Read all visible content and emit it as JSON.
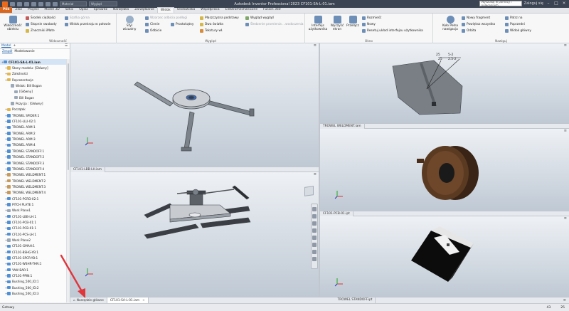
{
  "titlebar": {
    "material_label": "Materiał",
    "appearance_label": "Wygląd",
    "window_title": "Autodesk Inventor Professional 2023    CF101-SA-L-01.iam",
    "help_search_placeholder": "Wyszukaj w pomocy i poleceniach...",
    "user_label": "Zaloguj się"
  },
  "tabs": [
    "Plik",
    "Złóż",
    "Projekt",
    "Model 3D",
    "Szkic",
    "Opisz",
    "Sprawdź",
    "Narzędzia",
    "Zarządzanie",
    "Widok",
    "Środowiska",
    "Współpraca",
    "Elektromechaniczne",
    "Fusion 360"
  ],
  "ribbon": {
    "visibility": {
      "title": "Widoczność",
      "object_visibility": "Widoczność obiektu",
      "center_of_gravity": "Środek ciężkości",
      "degrees_of_freedom": "Stopnie swobody",
      "imate_glyphs": "Znaczniki iMate",
      "hide_others": "Szafka górna",
      "half_section": "Widok przekroju w połowie"
    },
    "appearance": {
      "title": "Wygląd",
      "visual_style": "Styl wizualny",
      "ground_plane": "Wzorzec odbicia podłogi",
      "shadows": "Cienie",
      "reflections": "Odbicie",
      "orthographic": "Prostokątny",
      "ground_plane2": "Płaszczyzna podstawy",
      "two_lights": "Dwa światła",
      "textures": "Tekstury wł.",
      "appearance_style": "Wygląd wygląd",
      "ray_tracing": "Śledzenie promienia ...wodoczenia"
    },
    "window": {
      "title": "Okno",
      "user_interface": "Interfejs użytkownika",
      "clean_screen": "Wyczyść ekran",
      "switch": "Przełącz",
      "arrange": "Rozmieść",
      "new": "Nowy",
      "reset_layout": "Resetuj układ interfejsu użytkownika"
    },
    "navigation": {
      "title": "Nawiguj",
      "full_nav_wheel": "Koło Pełna nawigacja",
      "new_fragment": "Nowy fragment",
      "zoom_all": "Powiększ wszystko",
      "orbit": "Orbita",
      "look_at": "Patrz na",
      "previous": "Poprzedni",
      "home_view": "Widok główny"
    }
  },
  "browser": {
    "tabs": [
      "Model",
      "+"
    ],
    "subtabs": [
      "Zespół",
      "Modelowanie"
    ],
    "tree": [
      {
        "label": "CF101-SA-L-01.iam",
        "icon": "assembly-icon",
        "indent": 0,
        "bold": true
      },
      {
        "label": "Stany modelu: [Główny]",
        "icon": "folder-icon",
        "indent": 1
      },
      {
        "label": "Zależności",
        "icon": "folder-icon",
        "indent": 1
      },
      {
        "label": "Reprezentacje",
        "icon": "folder-icon",
        "indent": 1
      },
      {
        "label": "Widok: Bill Bogan",
        "icon": "view-icon",
        "indent": 2
      },
      {
        "label": "[Główny]",
        "icon": "view-icon",
        "indent": 3
      },
      {
        "label": "Bill Bogan",
        "icon": "view-icon",
        "indent": 3
      },
      {
        "label": "Pozycja : [Główny]",
        "icon": "view-icon",
        "indent": 2
      },
      {
        "label": "Początek",
        "icon": "folder-icon",
        "indent": 1
      },
      {
        "label": "TROWEL SPIDER:1",
        "icon": "part-icon",
        "indent": 1
      },
      {
        "label": "CF101-LLU-02:1",
        "icon": "part-icon",
        "indent": 1
      },
      {
        "label": "TROWEL ARM:1",
        "icon": "part-icon",
        "indent": 1
      },
      {
        "label": "TROWEL ARM:2",
        "icon": "part-icon",
        "indent": 1
      },
      {
        "label": "TROWEL ARM:3",
        "icon": "part-icon",
        "indent": 1
      },
      {
        "label": "TROWEL ARM:4",
        "icon": "part-icon",
        "indent": 1
      },
      {
        "label": "TROWEL STANDOFF:1",
        "icon": "part-icon",
        "indent": 1
      },
      {
        "label": "TROWEL STANDOFF:2",
        "icon": "part-icon",
        "indent": 1
      },
      {
        "label": "TROWEL STANDOFF:3",
        "icon": "part-icon",
        "indent": 1
      },
      {
        "label": "TROWEL STANDOFF:4",
        "icon": "part-icon",
        "indent": 1
      },
      {
        "label": "TROWEL WELDMENT:1",
        "icon": "weldment-icon",
        "indent": 1
      },
      {
        "label": "TROWEL WELDMENT:2",
        "icon": "weldment-icon",
        "indent": 1
      },
      {
        "label": "TROWEL WELDMENT:3",
        "icon": "weldment-icon",
        "indent": 1
      },
      {
        "label": "TROWEL WELDMENT:4",
        "icon": "weldment-icon",
        "indent": 1
      },
      {
        "label": "CF101-PCRD-02:1",
        "icon": "part-icon",
        "indent": 1
      },
      {
        "label": "PITCH PLATE:1",
        "icon": "part-icon",
        "indent": 1
      },
      {
        "label": "Work Plane1",
        "icon": "plane-icon",
        "indent": 1
      },
      {
        "label": "CF101-LBB-LH:1",
        "icon": "part-icon",
        "indent": 1
      },
      {
        "label": "CF101-PCB-01:1",
        "icon": "part-icon",
        "indent": 1
      },
      {
        "label": "CF101-PCB-01:1",
        "icon": "part-icon",
        "indent": 1
      },
      {
        "label": "CF101-PCS-LH:1",
        "icon": "part-icon",
        "indent": 1
      },
      {
        "label": "Work Plane2",
        "icon": "plane-icon",
        "indent": 1
      },
      {
        "label": "CF101-GMAH:1",
        "icon": "part-icon",
        "indent": 1
      },
      {
        "label": "CF101-BSHG-YB:1",
        "icon": "part-icon",
        "indent": 1
      },
      {
        "label": "CF101-SPCR-YB:1",
        "icon": "part-icon",
        "indent": 1
      },
      {
        "label": "CF101-WSHR-THN:1",
        "icon": "part-icon",
        "indent": 1
      },
      {
        "label": "YAW BAR:1",
        "icon": "part-icon",
        "indent": 1
      },
      {
        "label": "CF101-PPIN:1",
        "icon": "part-icon",
        "indent": 1
      },
      {
        "label": "Bushing_500_ID:1",
        "icon": "part-icon",
        "indent": 1
      },
      {
        "label": "Bushing_500_ID:2",
        "icon": "part-icon",
        "indent": 1
      },
      {
        "label": "Bushing_500_ID:3",
        "icon": "part-icon",
        "indent": 1
      }
    ]
  },
  "viewports": {
    "top_left_caption": "CF101-LBB-LH.iam",
    "bottom_left_caption": "CF101-SA-L-01.iam",
    "top_right_caption": "TROWEL WELDMENT.iam",
    "mid_right_caption": "CF101-PCB-01.ipt",
    "bottom_right_caption": "TROWEL STANDOFF.ipt",
    "annotation_texts": [
      "25",
      "5-2",
      "25",
      "2.5-2"
    ]
  },
  "doc_tabs": [
    "Narzędzie główne",
    "CF101-SA-L-01.iam"
  ],
  "status": {
    "left": "Gotowy",
    "num1": "43",
    "num2": "25"
  }
}
